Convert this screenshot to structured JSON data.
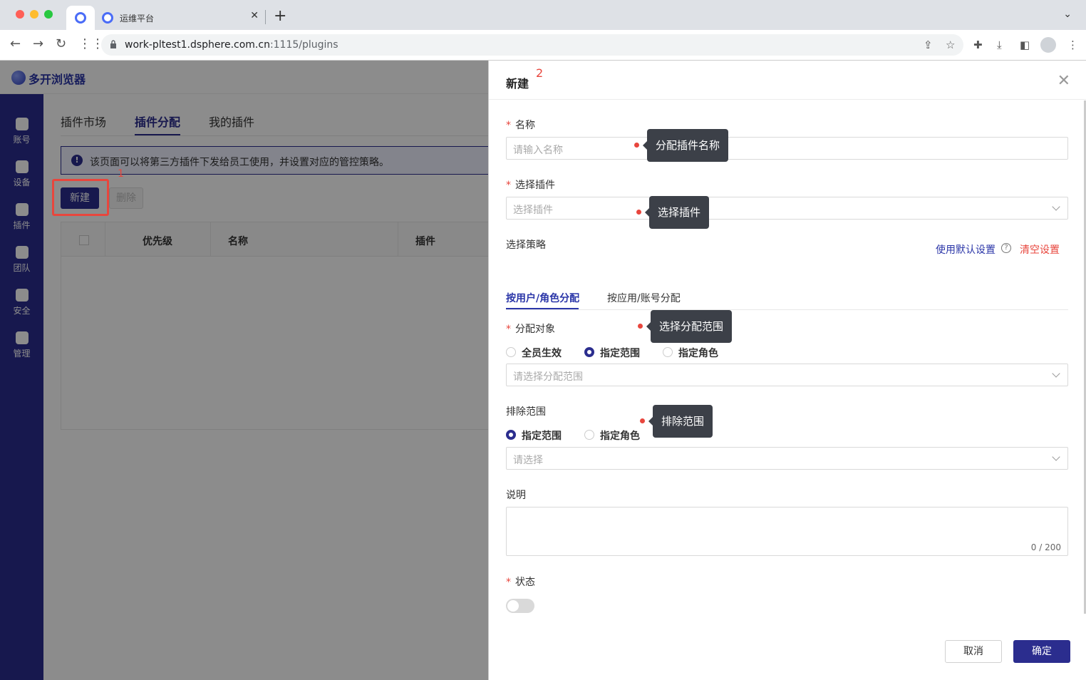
{
  "browser": {
    "tab_title": "运维平台",
    "url_host": "work-pltest1.dsphere.com.cn",
    "url_rest": ":1115/plugins"
  },
  "app": {
    "brand": "多开浏览器",
    "sidebar": [
      "账号",
      "设备",
      "插件",
      "团队",
      "安全",
      "管理"
    ],
    "tabs": [
      "插件市场",
      "插件分配",
      "我的插件"
    ],
    "notice": "该页面可以将第三方插件下发给员工使用，并设置对应的管控策略。",
    "new_button": "新建",
    "delete_button": "删除",
    "step1": "1",
    "columns": [
      "优先级",
      "名称",
      "插件"
    ]
  },
  "drawer": {
    "title": "新建",
    "step2": "2",
    "name_label": "名称",
    "name_placeholder": "请输入名称",
    "plugin_label": "选择插件",
    "plugin_placeholder": "选择插件",
    "policy_label": "选择策略",
    "use_default": "使用默认设置",
    "clear": "清空设置",
    "sub_tabs": [
      "按用户/角色分配",
      "按应用/账号分配"
    ],
    "target_label": "分配对象",
    "target_options": [
      "全员生效",
      "指定范围",
      "指定角色"
    ],
    "target_selected": 1,
    "target_placeholder": "请选择分配范围",
    "exclude_label": "排除范围",
    "exclude_options": [
      "指定范围",
      "指定角色"
    ],
    "exclude_selected": 0,
    "exclude_placeholder": "请选择",
    "desc_label": "说明",
    "counter": "0 / 200",
    "status_label": "状态",
    "status_on": false,
    "cancel": "取消",
    "confirm": "确定"
  },
  "tooltips": [
    "分配插件名称",
    "选择插件",
    "选择分配范围",
    "排除范围"
  ],
  "colors": {
    "primary": "#2b2d8e",
    "link": "#2b36a8",
    "danger": "#e8463d"
  }
}
